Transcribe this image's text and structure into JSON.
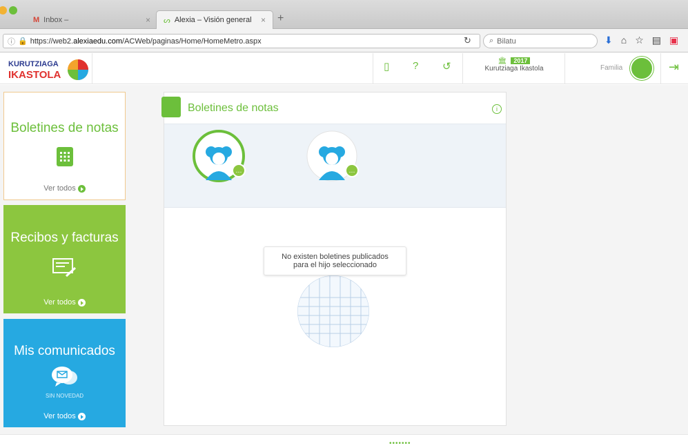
{
  "browser": {
    "tabs": [
      {
        "label": "Inbox –"
      },
      {
        "label": "Alexia – Visión general"
      }
    ],
    "url_prefix": "https://web2.",
    "url_domain": "alexiaedu.com",
    "url_path": "/ACWeb/paginas/Home/HomeMetro.aspx",
    "search_placeholder": "Bilatu"
  },
  "header": {
    "school_name": "Kurutziaga Ikastola",
    "year": "2017",
    "user_role": "Familia"
  },
  "cards": [
    {
      "title": "Boletines de notas",
      "more": "Ver todos"
    },
    {
      "title": "Recibos y facturas",
      "more": "Ver todos"
    },
    {
      "title": "Mis comunicados",
      "status": "SIN NOVEDAD",
      "more": "Ver todos"
    }
  ],
  "panel": {
    "title": "Boletines de notas",
    "empty_line1": "No existen boletines publicados",
    "empty_line2": "para el hijo seleccionado"
  },
  "colors": {
    "accent": "#6cbf3b",
    "green_card": "#8cc63f",
    "blue_card": "#26a9e1"
  }
}
